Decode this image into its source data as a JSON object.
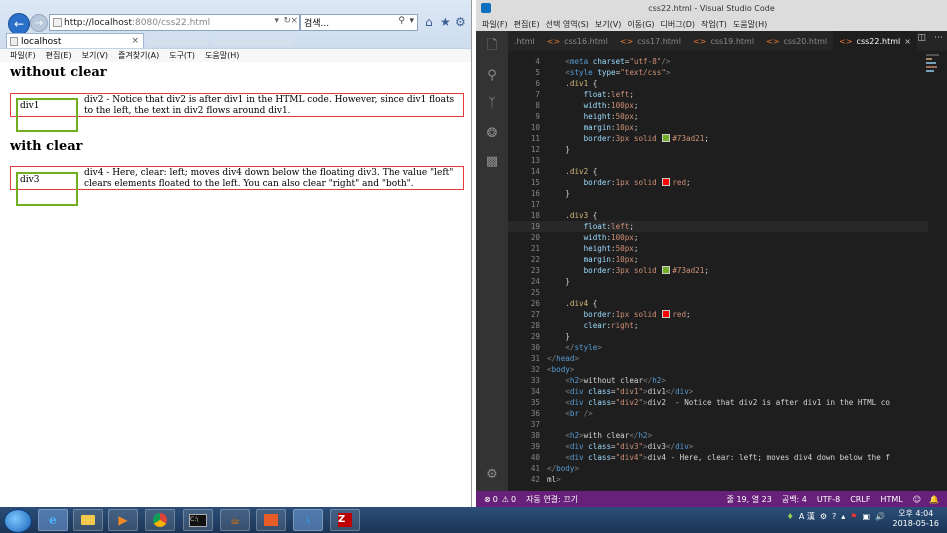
{
  "ie": {
    "url_host": "http://localhost",
    "url_rest": ":8080/css22.html",
    "search_placeholder": "검색...",
    "tab_label": "localhost",
    "menu": [
      "파일(F)",
      "편집(E)",
      "보기(V)",
      "즐겨찾기(A)",
      "도구(T)",
      "도움말(H)"
    ],
    "page": {
      "h2_without": "without clear",
      "div1_label": "div1",
      "div2_text": "div2 - Notice that div2 is after div1 in the HTML code. However, since div1 floats to the left, the text in div2 flows around div1.",
      "h2_with": "with clear",
      "div3_label": "div3",
      "div4_text": "div4 - Here, clear: left; moves div4 down below the floating div3. The value \"left\" clears elements floated to the left. You can also clear \"right\" and \"both\"."
    }
  },
  "vscode": {
    "title": "css22.html - Visual Studio Code",
    "menu": [
      "파일(F)",
      "편집(E)",
      "선택 영역(S)",
      "보기(V)",
      "이동(G)",
      "디버그(D)",
      "작업(T)",
      "도움말(H)"
    ],
    "tabs": [
      ".html",
      "css16.html",
      "css17.html",
      "css19.html",
      "css20.html",
      "css22.html"
    ],
    "active_tab_index": 5,
    "status": {
      "errors": "0",
      "warnings": "0",
      "auto_attach": "자동 연결: 끄기",
      "position": "줄 19, 열 23",
      "spaces": "공백: 4",
      "encoding": "UTF-8",
      "eol": "CRLF",
      "language": "HTML"
    },
    "code_lines": [
      {
        "n": "4",
        "segs": [
          [
            "t",
            "    "
          ],
          [
            "br",
            "<"
          ],
          [
            "tag",
            "meta"
          ],
          [
            "t",
            " "
          ],
          [
            "attr",
            "charset"
          ],
          [
            "t",
            "="
          ],
          [
            "str",
            "\"utf-8\""
          ],
          [
            "br",
            "/>"
          ]
        ]
      },
      {
        "n": "5",
        "segs": [
          [
            "t",
            "    "
          ],
          [
            "br",
            "<"
          ],
          [
            "tag",
            "style"
          ],
          [
            "t",
            " "
          ],
          [
            "attr",
            "type"
          ],
          [
            "t",
            "="
          ],
          [
            "str",
            "\"text/css\""
          ],
          [
            "br",
            ">"
          ]
        ]
      },
      {
        "n": "6",
        "segs": [
          [
            "t",
            "    "
          ],
          [
            "sel",
            ".div1"
          ],
          [
            "t",
            " {"
          ]
        ]
      },
      {
        "n": "7",
        "segs": [
          [
            "t",
            "        "
          ],
          [
            "prop",
            "float"
          ],
          [
            "t",
            ":"
          ],
          [
            "val",
            "left"
          ],
          [
            "t",
            ";"
          ]
        ]
      },
      {
        "n": "8",
        "segs": [
          [
            "t",
            "        "
          ],
          [
            "prop",
            "width"
          ],
          [
            "t",
            ":"
          ],
          [
            "val",
            "100px"
          ],
          [
            "t",
            ";"
          ]
        ]
      },
      {
        "n": "9",
        "segs": [
          [
            "t",
            "        "
          ],
          [
            "prop",
            "height"
          ],
          [
            "t",
            ":"
          ],
          [
            "val",
            "50px"
          ],
          [
            "t",
            ";"
          ]
        ]
      },
      {
        "n": "10",
        "segs": [
          [
            "t",
            "        "
          ],
          [
            "prop",
            "margin"
          ],
          [
            "t",
            ":"
          ],
          [
            "val",
            "10px"
          ],
          [
            "t",
            ";"
          ]
        ]
      },
      {
        "n": "11",
        "segs": [
          [
            "t",
            "        "
          ],
          [
            "prop",
            "border"
          ],
          [
            "t",
            ":"
          ],
          [
            "val",
            "3px solid "
          ],
          [
            "sw",
            "#73ad21"
          ],
          [
            "val",
            "#73ad21"
          ],
          [
            "t",
            ";"
          ]
        ]
      },
      {
        "n": "12",
        "segs": [
          [
            "t",
            "    }"
          ]
        ]
      },
      {
        "n": "13",
        "segs": []
      },
      {
        "n": "14",
        "segs": [
          [
            "t",
            "    "
          ],
          [
            "sel",
            ".div2"
          ],
          [
            "t",
            " {"
          ]
        ]
      },
      {
        "n": "15",
        "segs": [
          [
            "t",
            "        "
          ],
          [
            "prop",
            "border"
          ],
          [
            "t",
            ":"
          ],
          [
            "val",
            "1px solid "
          ],
          [
            "sw",
            "#ff0000"
          ],
          [
            "val",
            "red"
          ],
          [
            "t",
            ";"
          ]
        ]
      },
      {
        "n": "16",
        "segs": [
          [
            "t",
            "    }"
          ]
        ]
      },
      {
        "n": "17",
        "segs": []
      },
      {
        "n": "18",
        "segs": [
          [
            "t",
            "    "
          ],
          [
            "sel",
            ".div3"
          ],
          [
            "t",
            " {"
          ]
        ]
      },
      {
        "n": "19",
        "cur": true,
        "segs": [
          [
            "t",
            "        "
          ],
          [
            "prop",
            "float"
          ],
          [
            "t",
            ":"
          ],
          [
            "val",
            "left"
          ],
          [
            "t",
            ";"
          ]
        ]
      },
      {
        "n": "20",
        "segs": [
          [
            "t",
            "        "
          ],
          [
            "prop",
            "width"
          ],
          [
            "t",
            ":"
          ],
          [
            "val",
            "100px"
          ],
          [
            "t",
            ";"
          ]
        ]
      },
      {
        "n": "21",
        "segs": [
          [
            "t",
            "        "
          ],
          [
            "prop",
            "height"
          ],
          [
            "t",
            ":"
          ],
          [
            "val",
            "50px"
          ],
          [
            "t",
            ";"
          ]
        ]
      },
      {
        "n": "22",
        "segs": [
          [
            "t",
            "        "
          ],
          [
            "prop",
            "margin"
          ],
          [
            "t",
            ":"
          ],
          [
            "val",
            "10px"
          ],
          [
            "t",
            ";"
          ]
        ]
      },
      {
        "n": "23",
        "segs": [
          [
            "t",
            "        "
          ],
          [
            "prop",
            "border"
          ],
          [
            "t",
            ":"
          ],
          [
            "val",
            "3px solid "
          ],
          [
            "sw",
            "#73ad21"
          ],
          [
            "val",
            "#73ad21"
          ],
          [
            "t",
            ";"
          ]
        ]
      },
      {
        "n": "24",
        "segs": [
          [
            "t",
            "    }"
          ]
        ]
      },
      {
        "n": "25",
        "segs": []
      },
      {
        "n": "26",
        "segs": [
          [
            "t",
            "    "
          ],
          [
            "sel",
            ".div4"
          ],
          [
            "t",
            " {"
          ]
        ]
      },
      {
        "n": "27",
        "segs": [
          [
            "t",
            "        "
          ],
          [
            "prop",
            "border"
          ],
          [
            "t",
            ":"
          ],
          [
            "val",
            "1px solid "
          ],
          [
            "sw",
            "#ff0000"
          ],
          [
            "val",
            "red"
          ],
          [
            "t",
            ";"
          ]
        ]
      },
      {
        "n": "28",
        "segs": [
          [
            "t",
            "        "
          ],
          [
            "prop",
            "clear"
          ],
          [
            "t",
            ":"
          ],
          [
            "val",
            "right"
          ],
          [
            "t",
            ";"
          ]
        ]
      },
      {
        "n": "29",
        "segs": [
          [
            "t",
            "    }"
          ]
        ]
      },
      {
        "n": "30",
        "segs": [
          [
            "t",
            "    "
          ],
          [
            "br",
            "</"
          ],
          [
            "tag",
            "style"
          ],
          [
            "br",
            ">"
          ]
        ]
      },
      {
        "n": "31",
        "segs": [
          [
            "br",
            "</"
          ],
          [
            "tag",
            "head"
          ],
          [
            "br",
            ">"
          ]
        ]
      },
      {
        "n": "32",
        "segs": [
          [
            "br",
            "<"
          ],
          [
            "tag",
            "body"
          ],
          [
            "br",
            ">"
          ]
        ]
      },
      {
        "n": "33",
        "segs": [
          [
            "t",
            "    "
          ],
          [
            "br",
            "<"
          ],
          [
            "tag",
            "h2"
          ],
          [
            "br",
            ">"
          ],
          [
            "t",
            "without clear"
          ],
          [
            "br",
            "</"
          ],
          [
            "tag",
            "h2"
          ],
          [
            "br",
            ">"
          ]
        ]
      },
      {
        "n": "34",
        "segs": [
          [
            "t",
            "    "
          ],
          [
            "br",
            "<"
          ],
          [
            "tag",
            "div"
          ],
          [
            "t",
            " "
          ],
          [
            "attr",
            "class"
          ],
          [
            "t",
            "="
          ],
          [
            "str",
            "\"div1\""
          ],
          [
            "br",
            ">"
          ],
          [
            "t",
            "div1"
          ],
          [
            "br",
            "</"
          ],
          [
            "tag",
            "div"
          ],
          [
            "br",
            ">"
          ]
        ]
      },
      {
        "n": "35",
        "segs": [
          [
            "t",
            "    "
          ],
          [
            "br",
            "<"
          ],
          [
            "tag",
            "div"
          ],
          [
            "t",
            " "
          ],
          [
            "attr",
            "class"
          ],
          [
            "t",
            "="
          ],
          [
            "str",
            "\"div2\""
          ],
          [
            "br",
            ">"
          ],
          [
            "t",
            "div2  - Notice that div2 is after div1 in the HTML co"
          ]
        ]
      },
      {
        "n": "36",
        "segs": [
          [
            "t",
            "    "
          ],
          [
            "br",
            "<"
          ],
          [
            "tag",
            "br"
          ],
          [
            "t",
            " "
          ],
          [
            "br",
            "/>"
          ]
        ]
      },
      {
        "n": "37",
        "segs": []
      },
      {
        "n": "38",
        "segs": [
          [
            "t",
            "    "
          ],
          [
            "br",
            "<"
          ],
          [
            "tag",
            "h2"
          ],
          [
            "br",
            ">"
          ],
          [
            "t",
            "with clear"
          ],
          [
            "br",
            "</"
          ],
          [
            "tag",
            "h2"
          ],
          [
            "br",
            ">"
          ]
        ]
      },
      {
        "n": "39",
        "segs": [
          [
            "t",
            "    "
          ],
          [
            "br",
            "<"
          ],
          [
            "tag",
            "div"
          ],
          [
            "t",
            " "
          ],
          [
            "attr",
            "class"
          ],
          [
            "t",
            "="
          ],
          [
            "str",
            "\"div3\""
          ],
          [
            "br",
            ">"
          ],
          [
            "t",
            "div3"
          ],
          [
            "br",
            "</"
          ],
          [
            "tag",
            "div"
          ],
          [
            "br",
            ">"
          ]
        ]
      },
      {
        "n": "40",
        "segs": [
          [
            "t",
            "    "
          ],
          [
            "br",
            "<"
          ],
          [
            "tag",
            "div"
          ],
          [
            "t",
            " "
          ],
          [
            "attr",
            "class"
          ],
          [
            "t",
            "="
          ],
          [
            "str",
            "\"div4\""
          ],
          [
            "br",
            ">"
          ],
          [
            "t",
            "div4 - Here, clear: left; moves div4 down below the f"
          ]
        ]
      },
      {
        "n": "41",
        "segs": [
          [
            "br",
            "</"
          ],
          [
            "tag",
            "body"
          ],
          [
            "br",
            ">"
          ]
        ]
      },
      {
        "n": "42",
        "segs": [
          [
            "t",
            "ml"
          ],
          [
            "br",
            ">"
          ]
        ]
      }
    ]
  },
  "taskbar": {
    "ime": "A 漢",
    "ampm_time": "오후 4:04",
    "date": "2018-05-16"
  },
  "colors": {
    "green_border": "#73ad21",
    "red_border": "#e53a3a",
    "vs_status": "#68217a"
  }
}
